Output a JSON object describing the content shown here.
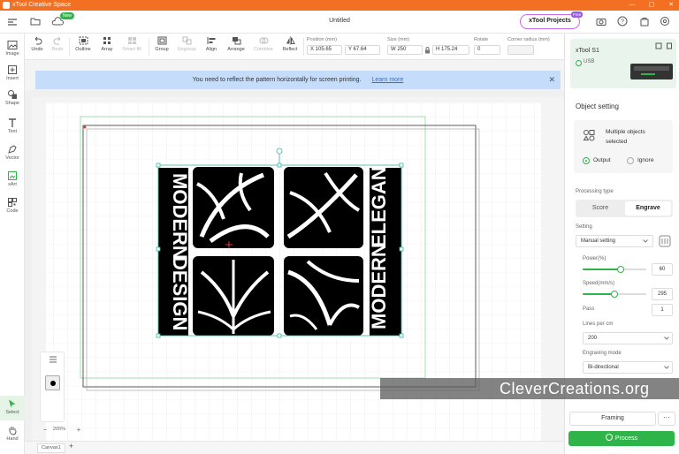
{
  "app": {
    "window_title": "xTool Creative Space",
    "document_title": "Untitled",
    "new_badge": "New",
    "projects_label": "xTool Projects",
    "free_badge": "Free"
  },
  "left_tools": [
    {
      "label": "Image",
      "icon": "image-icon"
    },
    {
      "label": "Insert",
      "icon": "insert-icon"
    },
    {
      "label": "Shape",
      "icon": "shape-icon"
    },
    {
      "label": "Text",
      "icon": "text-icon"
    },
    {
      "label": "Vector",
      "icon": "vector-pen-icon"
    },
    {
      "label": "xArt",
      "icon": "xart-icon"
    },
    {
      "label": "Code",
      "icon": "qr-code-icon"
    }
  ],
  "bottom_tools": [
    {
      "label": "Select",
      "icon": "select-cursor-icon"
    },
    {
      "label": "Hand",
      "icon": "hand-icon"
    }
  ],
  "toolbar": {
    "undo": "Undo",
    "redo": "Redo",
    "outline": "Outline",
    "array": "Array",
    "smart_fill": "Smart fill",
    "group": "Group",
    "ungroup": "Ungroup",
    "align": "Align",
    "arrange": "Arrange",
    "combine": "Combine",
    "reflect": "Reflect",
    "position_label": "Position (mm)",
    "x_value": "X 105.65",
    "y_value": "Y 67.64",
    "size_label": "Size (mm)",
    "w_value": "W 250",
    "h_value": "H 175.24",
    "rotate_label": "Rotate",
    "rotate_value": "0",
    "corner_label": "Corner radius (mm)",
    "corner_value": ""
  },
  "banner": {
    "message": "You need to reflect the pattern horizontally for screen printing.",
    "link": "Learn more"
  },
  "device": {
    "name": "xTool S1",
    "connection": "USB"
  },
  "object_setting": {
    "title": "Object setting",
    "selection_text": "Multiple objects selected",
    "output_label": "Output",
    "ignore_label": "Ignore",
    "processing_type_label": "Processing type",
    "score_label": "Score",
    "engrave_label": "Engrave",
    "setting_label": "Setting",
    "setting_value": "Manual setting",
    "power_label": "Power(%)",
    "power_value": "60",
    "power_fraction": 0.6,
    "speed_label": "Speed(mm/s)",
    "speed_value": "295",
    "speed_fraction": 0.5,
    "pass_label": "Pass",
    "pass_value": "1",
    "lines_label": "Lines per cm",
    "lines_value": "200",
    "mode_label": "Engraving mode",
    "mode_value": "Bi-directional"
  },
  "actions": {
    "framing": "Framing",
    "more": "···",
    "process": "Process"
  },
  "canvas": {
    "zoom": "205%",
    "tab_name": "Canvas1",
    "watermark": "CleverCreations.org",
    "left_text_top": "MODERN",
    "left_text_bottom": "DESIGN",
    "right_text_top": "ELEGANT",
    "right_text_bottom": "MODERN"
  },
  "colors": {
    "accent_green": "#2fb44a",
    "title_orange": "#f36f21",
    "banner_blue": "#c5dcfb"
  }
}
